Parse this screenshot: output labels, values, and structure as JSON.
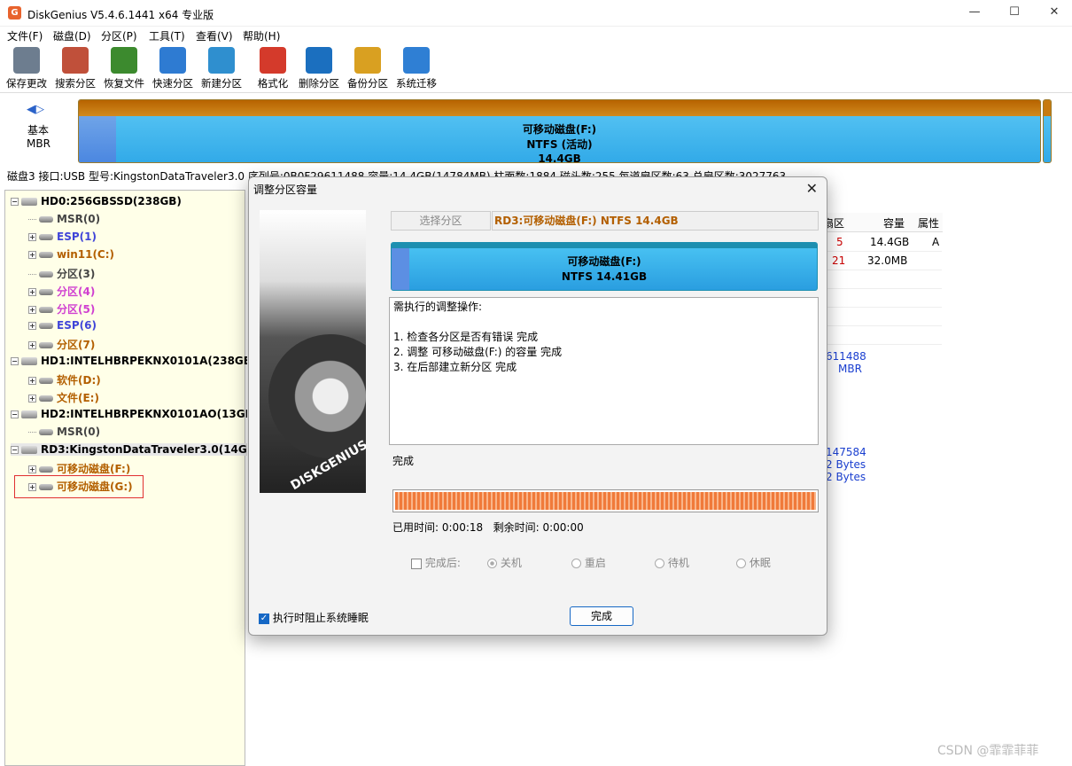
{
  "window": {
    "title": "DiskGenius V5.4.6.1441 x64 专业版",
    "app_icon_text": "G"
  },
  "menu": [
    "文件(F)",
    "磁盘(D)",
    "分区(P)",
    "工具(T)",
    "查看(V)",
    "帮助(H)"
  ],
  "toolbar": [
    {
      "label": "保存更改",
      "icon": "save-icon",
      "color": "#6d7d8f"
    },
    {
      "label": "搜索分区",
      "icon": "search-icon",
      "color": "#c0503a"
    },
    {
      "label": "恢复文件",
      "icon": "restore-icon",
      "color": "#3c8a2e"
    },
    {
      "label": "快速分区",
      "icon": "quick-partition-icon",
      "color": "#2e7bd2"
    },
    {
      "label": "新建分区",
      "icon": "new-partition-icon",
      "color": "#2f8fcf"
    },
    {
      "label": "格式化",
      "icon": "format-icon",
      "color": "#d43a2b"
    },
    {
      "label": "删除分区",
      "icon": "delete-partition-icon",
      "color": "#1b6fbf"
    },
    {
      "label": "备份分区",
      "icon": "backup-icon",
      "color": "#d9a021"
    },
    {
      "label": "系统迁移",
      "icon": "migrate-icon",
      "color": "#2f7fd4"
    }
  ],
  "disk": {
    "type": "基本",
    "table_type": "MBR",
    "bar_name": "可移动磁盘(F:)",
    "bar_fs": "NTFS (活动)",
    "bar_size": "14.4GB",
    "info": "磁盘3 接口:USB  型号:KingstonDataTraveler3.0  序列号:0B0F29611488  容量:14.4GB(14784MB)  柱面数:1884  磁头数:255  每道扇区数:63  总扇区数:30277632"
  },
  "tree": [
    {
      "label": "HD0:256GBSSD(238GB)",
      "kind": "disk",
      "color": "#000000"
    },
    {
      "label": "MSR(0)",
      "kind": "part",
      "color": "#444444"
    },
    {
      "label": "ESP(1)",
      "kind": "part",
      "color": "#3f44d8"
    },
    {
      "label": "win11(C:)",
      "kind": "part",
      "color": "#b35f00"
    },
    {
      "label": "分区(3)",
      "kind": "part",
      "color": "#444444"
    },
    {
      "label": "分区(4)",
      "kind": "part",
      "color": "#d040d0"
    },
    {
      "label": "分区(5)",
      "kind": "part",
      "color": "#d040d0"
    },
    {
      "label": "ESP(6)",
      "kind": "part",
      "color": "#3f44d8"
    },
    {
      "label": "分区(7)",
      "kind": "part",
      "color": "#b35f00"
    },
    {
      "label": "HD1:INTELHBRPEKNX0101A(238GB)",
      "kind": "disk",
      "color": "#000000"
    },
    {
      "label": "软件(D:)",
      "kind": "part",
      "color": "#b35f00"
    },
    {
      "label": "文件(E:)",
      "kind": "part",
      "color": "#b35f00"
    },
    {
      "label": "HD2:INTELHBRPEKNX0101AO(13GB)",
      "kind": "disk",
      "color": "#000000"
    },
    {
      "label": "MSR(0)",
      "kind": "part",
      "color": "#444444"
    },
    {
      "label": "RD3:KingstonDataTraveler3.0(14GB)",
      "kind": "disk",
      "color": "#000000"
    },
    {
      "label": "可移动磁盘(F:)",
      "kind": "part",
      "color": "#b35f00"
    },
    {
      "label": "可移动磁盘(G:)",
      "kind": "part",
      "color": "#b35f00"
    }
  ],
  "grid": {
    "headers": [
      "扇区",
      "容量",
      "属性"
    ],
    "rows": [
      {
        "sector": "5",
        "size": "14.4GB",
        "attr": "A"
      },
      {
        "sector": "21",
        "size": "32.0MB",
        "attr": ""
      }
    ]
  },
  "right_info": [
    "611488",
    "MBR",
    "147584",
    "2 Bytes",
    "2 Bytes"
  ],
  "dialog": {
    "title": "调整分区容量",
    "select_button": "选择分区",
    "selected_partition": "RD3:可移动磁盘(F:) NTFS 14.4GB",
    "part_name": "可移动磁盘(F:)",
    "part_fs_size": "NTFS 14.41GB",
    "ops_title": "需执行的调整操作:",
    "ops": [
      "1. 检查各分区是否有错误     完成",
      "2. 调整 可移动磁盘(F:) 的容量     完成",
      "3. 在后部建立新分区     完成"
    ],
    "status": "完成",
    "progress": 1.0,
    "elapsed_label": "已用时间:",
    "elapsed": "0:00:18",
    "remaining_label": "剩余时间:",
    "remaining": "0:00:00",
    "after_label": "完成后:",
    "after_options": [
      "关机",
      "重启",
      "待机",
      "休眠"
    ],
    "keep_awake": "执行时阻止系统睡眠",
    "done_button": "完成",
    "brand": "DISKGENIUS"
  },
  "watermark": "CSDN @霏霏菲菲"
}
